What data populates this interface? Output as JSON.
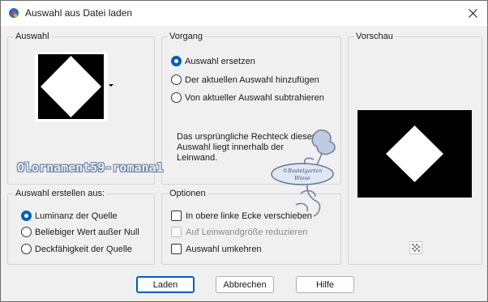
{
  "window": {
    "title": "Auswahl aus Datei laden"
  },
  "groups": {
    "auswahl": {
      "title": "Auswahl"
    },
    "vorgang": {
      "title": "Vorgang",
      "options": [
        {
          "label": "Auswahl ersetzen",
          "checked": true
        },
        {
          "label": "Der aktuellen Auswahl hinzufügen",
          "checked": false
        },
        {
          "label": "Von aktueller Auswahl subtrahieren",
          "checked": false
        }
      ],
      "info": "Das ursprüngliche Rechteck dieser Auswahl liegt innerhalb der Leinwand."
    },
    "vorschau": {
      "title": "Vorschau"
    },
    "erstellen": {
      "title": "Auswahl erstellen aus:",
      "options": [
        {
          "label": "Luminanz der Quelle",
          "checked": true
        },
        {
          "label": "Beliebiger Wert außer Null",
          "checked": false
        },
        {
          "label": "Deckfähigkeit der Quelle",
          "checked": false
        }
      ]
    },
    "optionen": {
      "title": "Optionen",
      "checks": [
        {
          "label": "In obere linke Ecke verschieben",
          "checked": false,
          "enabled": true
        },
        {
          "label": "Auf Leinwandgröße reduzieren",
          "checked": false,
          "enabled": false
        },
        {
          "label": "Auswahl umkehren",
          "checked": false,
          "enabled": true
        }
      ]
    }
  },
  "buttons": {
    "ok": "Laden",
    "cancel": "Abbrechen",
    "help": "Hilfe"
  },
  "watermark": {
    "text": "Olornament59-romana1",
    "logo": "©Bastelgarten Wiese"
  },
  "icons": {
    "app": "paintshop-icon",
    "close": "close-icon",
    "checker": "transparency-checker-icon"
  },
  "colors": {
    "accent": "#005fb8",
    "preview_bg": "#000000",
    "shape": "#ffffff"
  }
}
